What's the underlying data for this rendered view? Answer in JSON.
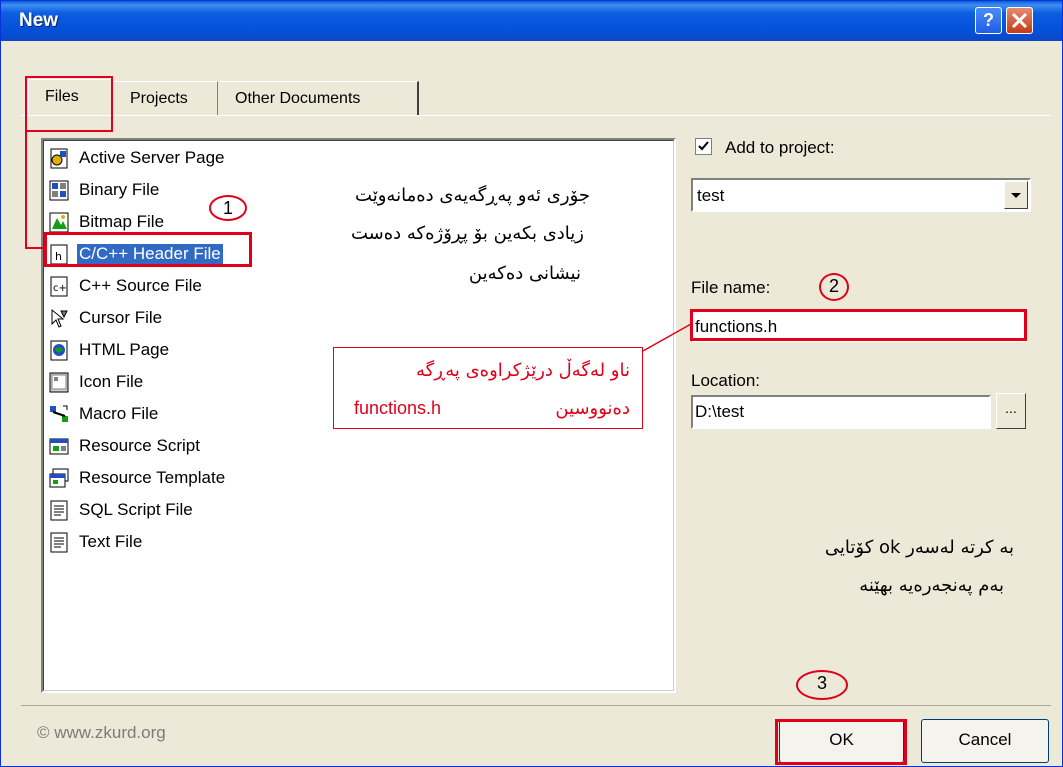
{
  "window": {
    "title": "New",
    "help_label": "?"
  },
  "tabs": [
    {
      "label": "Files"
    },
    {
      "label": "Projects"
    },
    {
      "label": "Other Documents"
    }
  ],
  "file_types": [
    {
      "label": "Active Server Page",
      "icon": "asp-icon"
    },
    {
      "label": "Binary File",
      "icon": "binary-file-icon"
    },
    {
      "label": "Bitmap File",
      "icon": "bitmap-icon"
    },
    {
      "label": "C/C++ Header File",
      "icon": "header-file-icon",
      "selected": true
    },
    {
      "label": "C++ Source File",
      "icon": "source-file-icon"
    },
    {
      "label": "Cursor File",
      "icon": "cursor-icon"
    },
    {
      "label": "HTML Page",
      "icon": "html-icon"
    },
    {
      "label": "Icon File",
      "icon": "icon-file-icon"
    },
    {
      "label": "Macro File",
      "icon": "macro-icon"
    },
    {
      "label": "Resource Script",
      "icon": "resource-script-icon"
    },
    {
      "label": "Resource Template",
      "icon": "resource-template-icon"
    },
    {
      "label": "SQL Script File",
      "icon": "sql-script-icon"
    },
    {
      "label": "Text File",
      "icon": "text-file-icon"
    }
  ],
  "right_panel": {
    "add_to_project_label": "Add to project:",
    "add_to_project_checked": true,
    "project_value": "test",
    "file_name_label": "File name:",
    "file_name_value": "functions.h",
    "location_label": "Location:",
    "location_value": "D:\\test",
    "browse_label": "..."
  },
  "annotations": {
    "step1_number": "1",
    "step2_number": "2",
    "step3_number": "3",
    "note1_line1": "جۆری ئەو پەڕگەیەی دەمانەوێت",
    "note1_line2": "زیادی بکەین بۆ پڕۆژەکە دەست",
    "note1_line3": "نیشانی دەکەین",
    "note2_line1": "ناو لەگەڵ درێژکراوەی پەڕگە",
    "note2_line2a": "functions.h",
    "note2_line2b": "دەنووسین",
    "note3_line1": "بە کرتە لەسەر ok کۆتایی",
    "note3_line2": "بەم پەنجەرەیە بهێنە"
  },
  "footer": {
    "copyright": "© www.zkurd.org",
    "ok_label": "OK",
    "cancel_label": "Cancel"
  },
  "colors": {
    "annotation_red": "#e0001a",
    "selection_blue": "#316ac5",
    "titlebar_blue": "#0551db"
  }
}
